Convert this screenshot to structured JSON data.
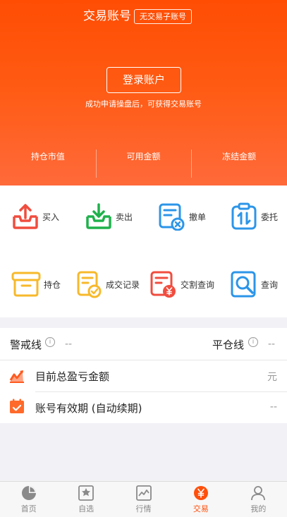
{
  "header": {
    "title": "交易账号",
    "badge": "无交易子账号",
    "login_button": "登录账户",
    "login_tip": "成功申请操盘后，可获得交易账号",
    "stats": [
      "持仓市值",
      "可用金额",
      "冻结金额"
    ]
  },
  "menu": [
    {
      "label": "买入",
      "icon": "tray-upload-icon",
      "color": "#f04d3f"
    },
    {
      "label": "卖出",
      "icon": "tray-download-icon",
      "color": "#1fb14b"
    },
    {
      "label": "撤单",
      "icon": "cancel-order-icon",
      "color": "#2c95e8"
    },
    {
      "label": "委托",
      "icon": "clipboard-arrows-icon",
      "color": "#2c95e8"
    },
    {
      "label": "持仓",
      "icon": "box-icon",
      "color": "#f7b92b"
    },
    {
      "label": "成交记录",
      "icon": "document-check-icon",
      "color": "#f7b92b"
    },
    {
      "label": "交割查询",
      "icon": "document-yen-icon",
      "color": "#f04d3f"
    },
    {
      "label": "查询",
      "icon": "magnifier-icon",
      "color": "#2c95e8"
    }
  ],
  "lines": {
    "warning_label": "警戒线",
    "warning_value": "--",
    "liquidation_label": "平仓线",
    "liquidation_value": "--"
  },
  "rows": [
    {
      "label": "目前总盈亏金额",
      "value": "元",
      "icon": "trend-chart-icon"
    },
    {
      "label": "账号有效期 (自动续期)",
      "value": "--",
      "icon": "calendar-check-icon"
    }
  ],
  "tabs": [
    {
      "label": "首页",
      "icon": "pie-chart-icon",
      "active": false
    },
    {
      "label": "自选",
      "icon": "bookmark-star-icon",
      "active": false
    },
    {
      "label": "行情",
      "icon": "line-chart-icon",
      "active": false
    },
    {
      "label": "交易",
      "icon": "yen-circle-icon",
      "active": true
    },
    {
      "label": "我的",
      "icon": "user-icon",
      "active": false
    }
  ],
  "colors": {
    "accent": "#ff4f0a",
    "header_top": "#ff4d04",
    "header_bottom": "#ff6a3a"
  }
}
